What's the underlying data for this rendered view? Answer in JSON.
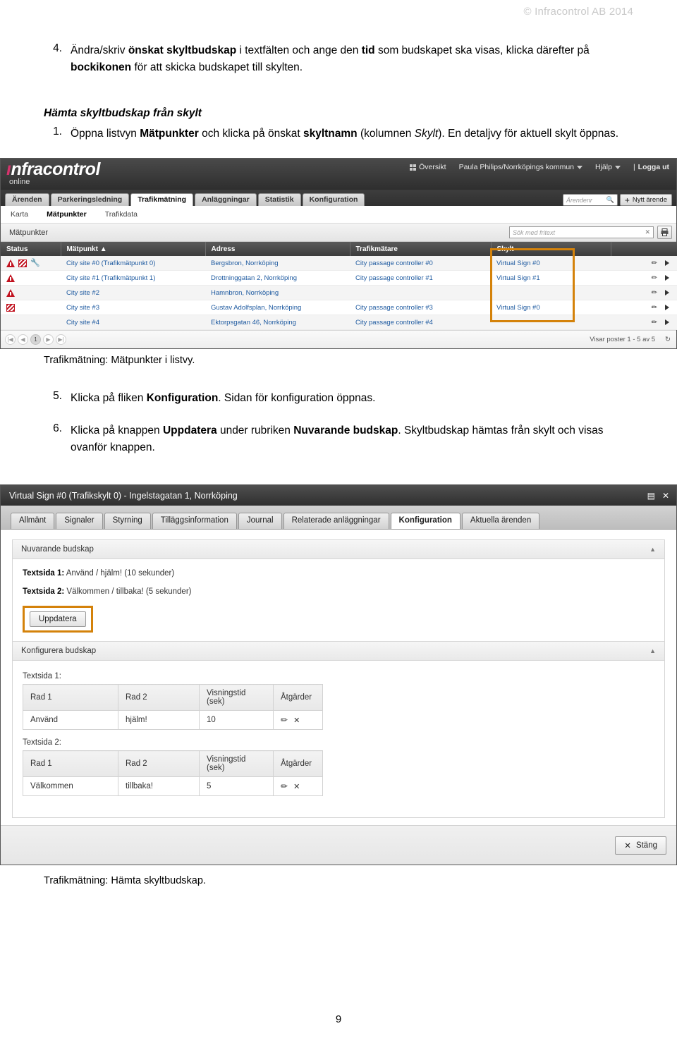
{
  "page": {
    "copyright": "© Infracontrol AB 2014",
    "page_number": "9"
  },
  "steps_top": [
    {
      "num": "4.",
      "parts": [
        {
          "t": "Ändra/skriv ",
          "s": "n"
        },
        {
          "t": "önskat skyltbudskap",
          "s": "b"
        },
        {
          "t": " i textfälten och ange den ",
          "s": "n"
        },
        {
          "t": "tid",
          "s": "b"
        },
        {
          "t": " som budskapet ska visas, klicka därefter på ",
          "s": "n"
        },
        {
          "t": "bockikonen",
          "s": "b"
        },
        {
          "t": " för att skicka budskapet till skylten.",
          "s": "n"
        }
      ]
    }
  ],
  "section_heading": "Hämta skyltbudskap från skylt",
  "steps_mid": [
    {
      "num": "1.",
      "parts": [
        {
          "t": "Öppna listvyn ",
          "s": "n"
        },
        {
          "t": "Mätpunkter",
          "s": "b"
        },
        {
          "t": " och klicka på önskat ",
          "s": "n"
        },
        {
          "t": "skyltnamn",
          "s": "b"
        },
        {
          "t": " (kolumnen ",
          "s": "n"
        },
        {
          "t": "Skylt",
          "s": "i"
        },
        {
          "t": "). En detaljvy för aktuell skylt öppnas.",
          "s": "n"
        }
      ]
    }
  ],
  "steps_after": [
    {
      "num": "5.",
      "parts": [
        {
          "t": "Klicka på fliken ",
          "s": "n"
        },
        {
          "t": "Konfiguration",
          "s": "b"
        },
        {
          "t": ". Sidan för konfiguration öppnas.",
          "s": "n"
        }
      ]
    },
    {
      "num": "6.",
      "parts": [
        {
          "t": "Klicka på knappen ",
          "s": "n"
        },
        {
          "t": "Uppdatera",
          "s": "b"
        },
        {
          "t": " under rubriken ",
          "s": "n"
        },
        {
          "t": "Nuvarande budskap",
          "s": "b"
        },
        {
          "t": ". Skyltbudskap hämtas från skylt och visas ovanför knappen.",
          "s": "n"
        }
      ]
    }
  ],
  "caption1": "Trafikmätning: Mätpunkter i listvy.",
  "caption2": "Trafikmätning: Hämta skyltbudskap.",
  "listview": {
    "logo": "nfracontrol",
    "logo_sub": "online",
    "topright": {
      "overview": "Översikt",
      "user": "Paula Philips/Norrköpings kommun",
      "help": "Hjälp",
      "logout": "Logga ut",
      "separator": "|"
    },
    "tabs": [
      {
        "label": "Ärenden",
        "active": false
      },
      {
        "label": "Parkeringsledning",
        "active": false
      },
      {
        "label": "Trafikmätning",
        "active": true
      },
      {
        "label": "Anläggningar",
        "active": false
      },
      {
        "label": "Statistik",
        "active": false
      },
      {
        "label": "Konfiguration",
        "active": false
      }
    ],
    "subnav": [
      {
        "label": "Karta",
        "active": false
      },
      {
        "label": "Mätpunkter",
        "active": true
      },
      {
        "label": "Trafikdata",
        "active": false
      }
    ],
    "case_search_placeholder": "Ärendenr",
    "new_case_label": "Nytt ärende",
    "new_case_plus": "+",
    "panel_title": "Mätpunkter",
    "free_search_placeholder": "Sök med fritext",
    "free_search_clear": "✕",
    "columns": [
      "Status",
      "Mätpunkt ▲",
      "Adress",
      "Trafikmätare",
      "Skylt",
      ""
    ],
    "rows": [
      {
        "status": [
          "warning",
          "striped",
          "wrench"
        ],
        "matpunkt": "City site #0 (Trafikmätpunkt 0)",
        "adress": "Bergsbron, Norrköping",
        "trafikmatare": "City passage controller #0",
        "skylt": "Virtual Sign #0"
      },
      {
        "status": [
          "warning"
        ],
        "matpunkt": "City site #1 (Trafikmätpunkt 1)",
        "adress": "Drottninggatan 2, Norrköping",
        "trafikmatare": "City passage controller #1",
        "skylt": "Virtual Sign #1"
      },
      {
        "status": [
          "warning"
        ],
        "matpunkt": "City site #2",
        "adress": "Hamnbron, Norrköping",
        "trafikmatare": "",
        "skylt": ""
      },
      {
        "status": [
          "striped"
        ],
        "matpunkt": "City site #3",
        "adress": "Gustav Adolfsplan, Norrköping",
        "trafikmatare": "City passage controller #3",
        "skylt": "Virtual Sign #0"
      },
      {
        "status": [],
        "matpunkt": "City site #4",
        "adress": "Ektorpsgatan 46, Norrköping",
        "trafikmatare": "City passage controller #4",
        "skylt": ""
      }
    ],
    "pager": {
      "first": "|◀",
      "prev": "◀",
      "current": "1",
      "next": "▶",
      "last": "▶|",
      "info": "Visar poster 1 - 5 av 5",
      "refresh": "↻"
    },
    "highlight_color": "#d4820a"
  },
  "detailview": {
    "title": "Virtual Sign #0 (Trafikskylt 0) - Ingelstagatan 1, Norrköping",
    "title_icons": {
      "save": "▤",
      "close": "✕"
    },
    "tabs": [
      {
        "label": "Allmänt",
        "active": false
      },
      {
        "label": "Signaler",
        "active": false
      },
      {
        "label": "Styrning",
        "active": false
      },
      {
        "label": "Tilläggsinformation",
        "active": false
      },
      {
        "label": "Journal",
        "active": false
      },
      {
        "label": "Relaterade anläggningar",
        "active": false
      },
      {
        "label": "Konfiguration",
        "active": true
      },
      {
        "label": "Aktuella ärenden",
        "active": false
      }
    ],
    "current_message": {
      "heading": "Nuvarande budskap",
      "collapse": "▲",
      "lines": [
        {
          "label": "Textsida 1:",
          "value": " Använd / hjälm! (10 sekunder)"
        },
        {
          "label": "Textsida 2:",
          "value": " Välkommen / tillbaka! (5 sekunder)"
        }
      ],
      "update_button": "Uppdatera"
    },
    "configure_message": {
      "heading": "Konfigurera budskap",
      "collapse": "▲",
      "columns": [
        "Rad 1",
        "Rad 2",
        "Visningstid (sek)",
        "Åtgärder"
      ],
      "groups": [
        {
          "label": "Textsida 1:",
          "row": {
            "rad1": "Använd",
            "rad2": "hjälm!",
            "tid": "10",
            "actions": [
              "edit",
              "delete"
            ]
          }
        },
        {
          "label": "Textsida 2:",
          "row": {
            "rad1": "Välkommen",
            "rad2": "tillbaka!",
            "tid": "5",
            "actions": [
              "edit",
              "delete"
            ]
          }
        }
      ]
    },
    "close_button": {
      "icon": "✕",
      "label": "Stäng"
    }
  }
}
